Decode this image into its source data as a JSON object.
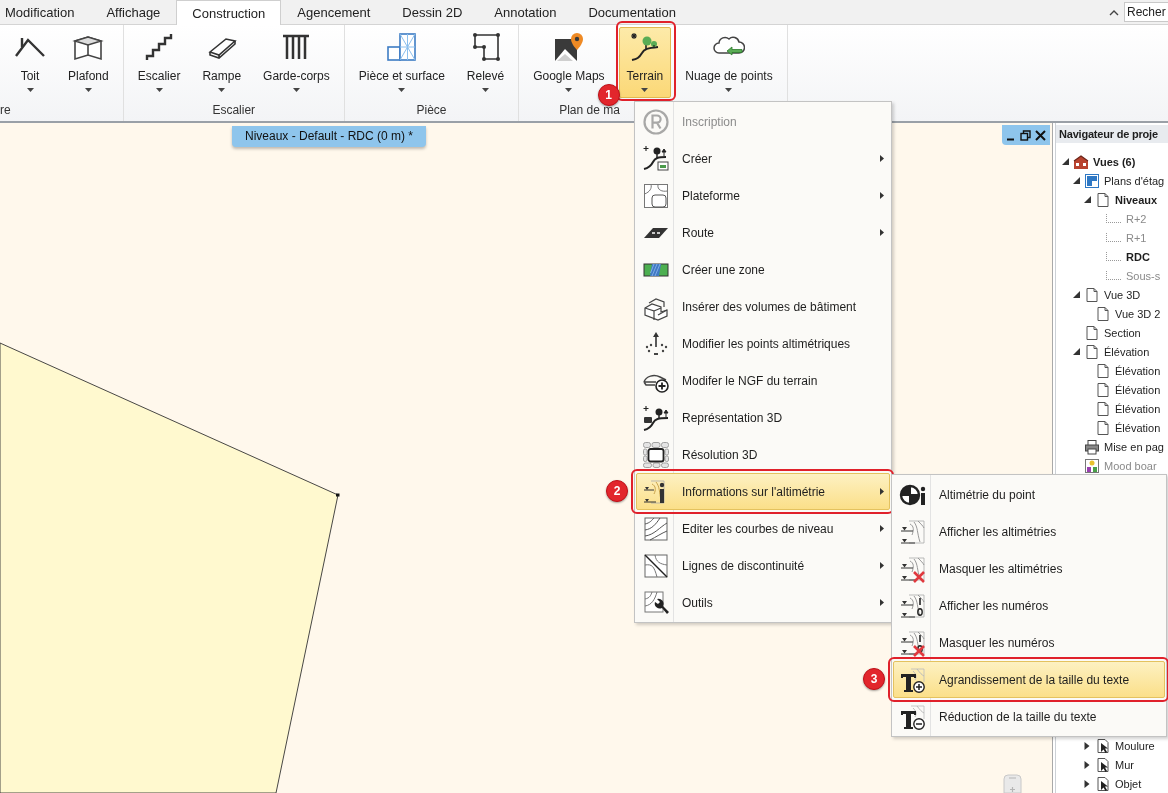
{
  "tabs": [
    {
      "label": "Modification",
      "selected": false
    },
    {
      "label": "Affichage",
      "selected": false
    },
    {
      "label": "Construction",
      "selected": true
    },
    {
      "label": "Agencement",
      "selected": false
    },
    {
      "label": "Dessin 2D",
      "selected": false
    },
    {
      "label": "Annotation",
      "selected": false
    },
    {
      "label": "Documentation",
      "selected": false
    }
  ],
  "search": {
    "placeholder": "Recher"
  },
  "ribbon": {
    "groups": [
      {
        "label": "re",
        "buttons": [
          {
            "label": "Toit",
            "selected": false
          },
          {
            "label": "Plafond",
            "selected": false
          }
        ]
      },
      {
        "label": "Escalier",
        "buttons": [
          {
            "label": "Escalier",
            "selected": false
          },
          {
            "label": "Rampe",
            "selected": false
          },
          {
            "label": "Garde-corps",
            "selected": false
          }
        ]
      },
      {
        "label": "Pièce",
        "buttons": [
          {
            "label": "Pièce et surface",
            "selected": false
          },
          {
            "label": "Relevé",
            "selected": false
          }
        ]
      },
      {
        "label": "Plan de ma",
        "buttons": [
          {
            "label": "Google Maps",
            "selected": false
          },
          {
            "label": "Terrain",
            "selected": true,
            "callout": "1"
          },
          {
            "label": "Nuage de points",
            "selected": false
          }
        ]
      }
    ]
  },
  "canvas": {
    "view_tab": "Niveaux - Default - RDC (0 m) *"
  },
  "navigator": {
    "title": "Navigateur de proje",
    "tree": [
      {
        "label": "Vues (6)",
        "kind": "views",
        "expanded": true,
        "current": true,
        "dimmed": false,
        "children": [
          {
            "label": "Plans d'étag",
            "kind": "plans",
            "expanded": true,
            "current": false,
            "dimmed": false,
            "children": [
              {
                "label": "Niveaux",
                "kind": "page",
                "expanded": true,
                "current": true,
                "dimmed": false,
                "children": [
                  {
                    "label": "R+2",
                    "kind": "level",
                    "current": false,
                    "dimmed": true
                  },
                  {
                    "label": "R+1",
                    "kind": "level",
                    "current": false,
                    "dimmed": true
                  },
                  {
                    "label": "RDC",
                    "kind": "level",
                    "current": true,
                    "dimmed": false
                  },
                  {
                    "label": "Sous-s",
                    "kind": "level",
                    "current": false,
                    "dimmed": true
                  }
                ]
              }
            ]
          },
          {
            "label": "Vue 3D",
            "kind": "page",
            "expanded": true,
            "current": false,
            "dimmed": false,
            "children": [
              {
                "label": "Vue 3D 2",
                "kind": "page",
                "current": false,
                "dimmed": false
              }
            ]
          },
          {
            "label": "Section",
            "kind": "page",
            "current": false,
            "dimmed": false
          },
          {
            "label": "Élévation",
            "kind": "page",
            "expanded": true,
            "current": false,
            "dimmed": false,
            "children": [
              {
                "label": "Élévation",
                "kind": "page",
                "current": false,
                "dimmed": false
              },
              {
                "label": "Élévation",
                "kind": "page",
                "current": false,
                "dimmed": false
              },
              {
                "label": "Élévation",
                "kind": "page",
                "current": false,
                "dimmed": false
              },
              {
                "label": "Élévation",
                "kind": "page",
                "current": false,
                "dimmed": false
              }
            ]
          },
          {
            "label": "Mise en pag",
            "kind": "printer",
            "current": false,
            "dimmed": false
          },
          {
            "label": "Mood boar",
            "kind": "board",
            "current": false,
            "dimmed": true
          }
        ]
      }
    ],
    "tree_lower": [
      {
        "label": "Moulure",
        "kind": "object",
        "expanded": false,
        "current": false,
        "dimmed": false
      },
      {
        "label": "Mur",
        "kind": "object",
        "expanded": false,
        "current": false,
        "dimmed": false
      },
      {
        "label": "Objet",
        "kind": "object",
        "expanded": false,
        "current": false,
        "dimmed": false
      }
    ]
  },
  "terrain_menu": {
    "items": [
      {
        "label": "Inscription",
        "disabled": true,
        "submenu": false,
        "selected": false
      },
      {
        "label": "Créer",
        "disabled": false,
        "submenu": true,
        "selected": false
      },
      {
        "label": "Plateforme",
        "disabled": false,
        "submenu": true,
        "selected": false
      },
      {
        "label": "Route",
        "disabled": false,
        "submenu": true,
        "selected": false
      },
      {
        "label": "Créer une zone",
        "disabled": false,
        "submenu": false,
        "selected": false
      },
      {
        "label": "Insérer des volumes de bâtiment",
        "disabled": false,
        "submenu": false,
        "selected": false
      },
      {
        "label": "Modifier les points altimétriques",
        "disabled": false,
        "submenu": false,
        "selected": false
      },
      {
        "label": "Modifer le NGF du terrain",
        "disabled": false,
        "submenu": false,
        "selected": false
      },
      {
        "label": "Représentation 3D",
        "disabled": false,
        "submenu": false,
        "selected": false
      },
      {
        "label": "Résolution 3D",
        "disabled": false,
        "submenu": false,
        "selected": false
      },
      {
        "label": "Informations sur l'altimétrie",
        "disabled": false,
        "submenu": true,
        "selected": true,
        "callout": "2"
      },
      {
        "label": "Editer les courbes de niveau",
        "disabled": false,
        "submenu": true,
        "selected": false
      },
      {
        "label": "Lignes de discontinuité",
        "disabled": false,
        "submenu": true,
        "selected": false
      },
      {
        "label": "Outils",
        "disabled": false,
        "submenu": true,
        "selected": false
      }
    ]
  },
  "altimetry_submenu": {
    "items": [
      {
        "label": "Altimétrie du point",
        "selected": false
      },
      {
        "label": "Afficher les altimétries",
        "selected": false
      },
      {
        "label": "Masquer les altimétries",
        "selected": false
      },
      {
        "label": "Afficher les numéros",
        "selected": false
      },
      {
        "label": "Masquer les numéros",
        "selected": false
      },
      {
        "label": "Agrandissement de la taille du texte",
        "selected": true,
        "callout": "3"
      },
      {
        "label": "Réduction de la taille du texte",
        "selected": false
      }
    ]
  }
}
